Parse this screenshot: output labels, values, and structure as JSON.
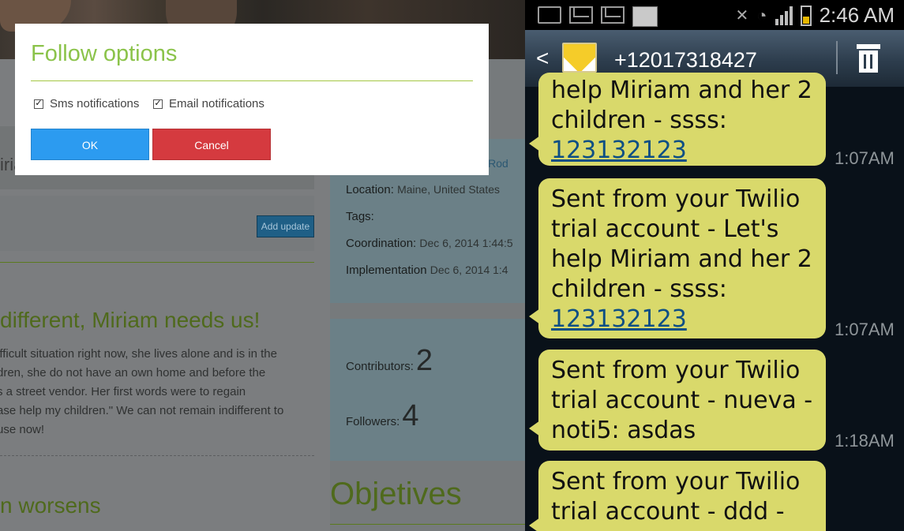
{
  "web": {
    "add_update_label": "Add update",
    "name_fragment": "iria",
    "story_title": "different, Miriam needs us!",
    "story_lines": [
      "ifficult situation right now, she lives alone and is in the",
      "dren, she do not have an own home and before the",
      "s a street vendor. Her first words were to regain",
      "ase help my children.\" We can not remain indifferent to",
      "use now!"
    ],
    "worsens_title": "n worsens",
    "info": {
      "link_fragment": "era Rod",
      "location_label": "Location:",
      "location_value": "Maine, United States",
      "tags_label": "Tags:",
      "coordination_label": "Coordination:",
      "coordination_value": "Dec 6, 2014 1:44:5",
      "implementation_label": "Implementation",
      "implementation_value": "Dec 6, 2014 1:4"
    },
    "stats": {
      "contributors_label": "Contributors:",
      "contributors_value": "2",
      "followers_label": "Followers:",
      "followers_value": "4"
    },
    "objetives_title": "Objetives"
  },
  "modal": {
    "title": "Follow options",
    "sms_label": "Sms notifications",
    "sms_checked": true,
    "email_label": "Email notifications",
    "email_checked": true,
    "ok_label": "OK",
    "cancel_label": "Cancel",
    "accent_color": "#8bc34a",
    "ok_color": "#2c9bf0",
    "cancel_color": "#d53a3f"
  },
  "phone": {
    "status": {
      "time": "2:46 AM",
      "icons": [
        "camera-icon",
        "gmail-icon",
        "gmail-icon",
        "card-icon",
        "mute-icon",
        "wifi-icon",
        "signal-icon",
        "battery-icon"
      ]
    },
    "contact": "+12017318427",
    "messages": [
      {
        "lines": [
          "help Miriam and her 2",
          "children - ssss:"
        ],
        "link": "123132123",
        "time": "1:07AM"
      },
      {
        "lines": [
          "Sent from your Twilio",
          "trial account - Let's",
          "help Miriam and her 2",
          "children - ssss:"
        ],
        "link": "123132123",
        "time": "1:07AM"
      },
      {
        "lines": [
          "Sent from your Twilio",
          "trial account - nueva -",
          "noti5: asdas"
        ],
        "link": null,
        "time": "1:18AM"
      },
      {
        "lines": [
          "Sent from your Twilio",
          "trial account - ddd -"
        ],
        "link": null,
        "time": ""
      }
    ]
  }
}
